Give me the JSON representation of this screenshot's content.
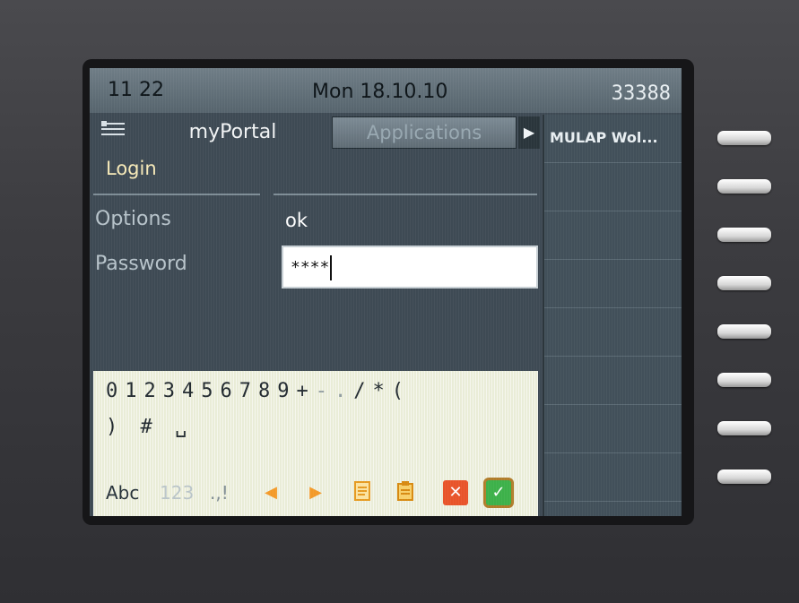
{
  "statusbar": {
    "time": "11 22",
    "date": "Mon 18.10.10",
    "extension": "33388"
  },
  "tabs": {
    "menu_icon": "menu-icon",
    "active_label": "myPortal",
    "inactive_label": "Applications",
    "scroll_icon": "arrow-right-icon"
  },
  "form": {
    "title": "Login",
    "options_label": "Options",
    "options_value": "ok",
    "password_label": "Password",
    "password_value": "****"
  },
  "side_panel": {
    "items": [
      "MULAP Wol...",
      "",
      "",
      "",
      "",
      "",
      "",
      ""
    ]
  },
  "keyboard": {
    "row1": [
      "0",
      "1",
      "2",
      "3",
      "4",
      "5",
      "6",
      "7",
      "8",
      "9",
      "+",
      "-",
      ".",
      "/",
      "*",
      "("
    ],
    "row2": [
      ")",
      "#",
      "␣"
    ],
    "modes": {
      "abc": "Abc",
      "num": "123",
      "sym": ".,!"
    },
    "buttons": {
      "left": "◀",
      "right": "▶",
      "copy": "copy-icon",
      "paste": "paste-icon",
      "cancel": "✕",
      "confirm": "✓"
    }
  },
  "colors": {
    "screen_bg": "#3e4a54",
    "accent_login": "#f6e9b8",
    "cancel": "#e8542a",
    "confirm": "#3db14a"
  }
}
